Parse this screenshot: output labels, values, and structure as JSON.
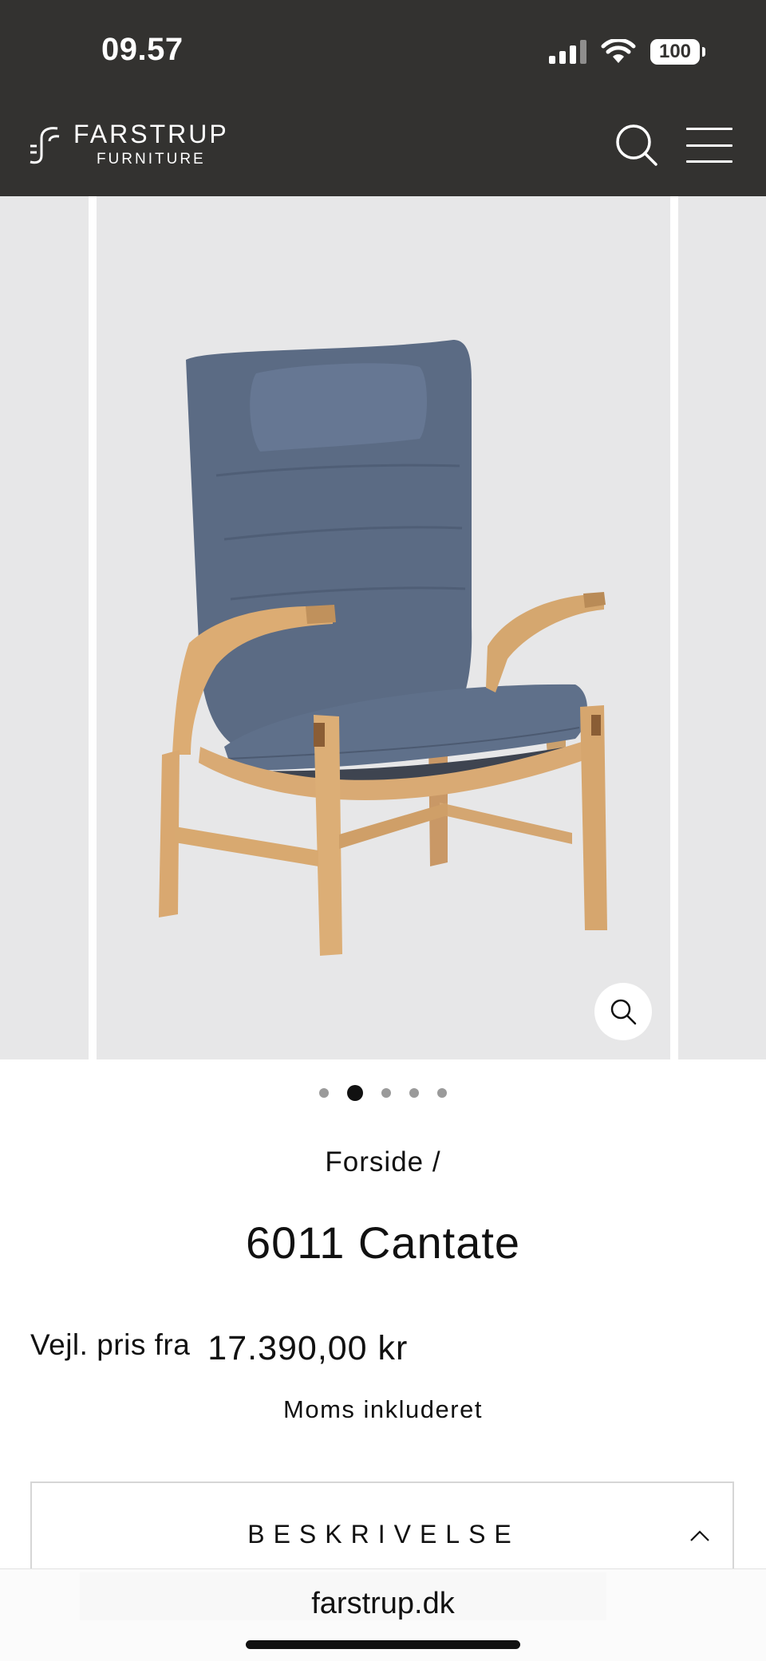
{
  "status_bar": {
    "time": "09.57",
    "battery": "100"
  },
  "header": {
    "logo_line1": "FARSTRUP",
    "logo_line2": "FURNITURE",
    "background_color": "#333230"
  },
  "carousel": {
    "image": "chair-photo",
    "active_slide": 2,
    "slide_count": 5
  },
  "product": {
    "breadcrumb": "Forside /",
    "title": "6011 Cantate",
    "price_label": "Vejl. pris fra",
    "price_value": "17.390,00 kr",
    "tax_note": "Moms inkluderet"
  },
  "accordion": {
    "label": "BESKRIVELSE",
    "expanded": true
  },
  "browser": {
    "url": "farstrup.dk"
  }
}
